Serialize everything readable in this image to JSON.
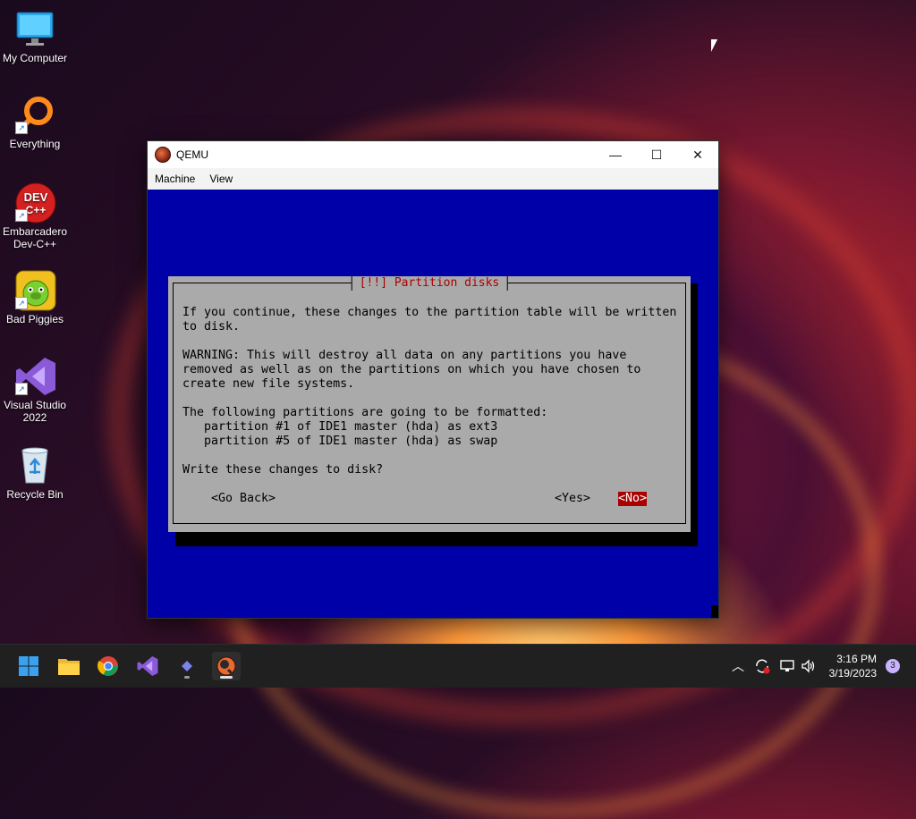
{
  "desktop": {
    "icons": [
      {
        "label": "My Computer",
        "icon": "monitor-icon"
      },
      {
        "label": "Everything",
        "icon": "magnifier-icon"
      },
      {
        "label": "Embarcadero Dev-C++",
        "line1": "Embarcadero",
        "line2": "Dev-C++",
        "badge": "DEV C++",
        "icon": "devcpp-icon"
      },
      {
        "label": "Bad Piggies",
        "icon": "bad-piggies-icon"
      },
      {
        "label": "Visual Studio 2022",
        "line1": "Visual Studio",
        "line2": "2022",
        "icon": "visual-studio-icon"
      },
      {
        "label": "Recycle Bin",
        "icon": "recycle-bin-icon"
      }
    ]
  },
  "window": {
    "title": "QEMU",
    "controls": {
      "minimize": "—",
      "maximize": "☐",
      "close": "✕"
    },
    "menu": [
      "Machine",
      "View"
    ]
  },
  "installer": {
    "dialog_title": "[!!] Partition disks",
    "lines": [
      "If you continue, these changes to the partition table will be written",
      "to disk.",
      "",
      "WARNING: This will destroy all data on any partitions you have",
      "removed as well as on the partitions on which you have chosen to",
      "create new file systems.",
      "",
      "The following partitions are going to be formatted:",
      "   partition #1 of IDE1 master (hda) as ext3",
      "   partition #5 of IDE1 master (hda) as swap",
      "",
      "Write these changes to disk?"
    ],
    "buttons": {
      "go_back": "<Go Back>",
      "yes": "<Yes>",
      "no": "<No>"
    },
    "selected_button": "no"
  },
  "taskbar": {
    "apps": [
      "start",
      "file-explorer",
      "chrome",
      "visual-studio",
      "teams",
      "qemu"
    ],
    "tray": {
      "time": "3:16 PM",
      "date": "3/19/2023",
      "notifications": "3"
    }
  },
  "colors": {
    "vm_background": "#0000a8",
    "dialog_background": "#aaaaaa",
    "dialog_title": "#aa0000",
    "selected_button": "#aa0000",
    "taskbar": "#202020"
  }
}
